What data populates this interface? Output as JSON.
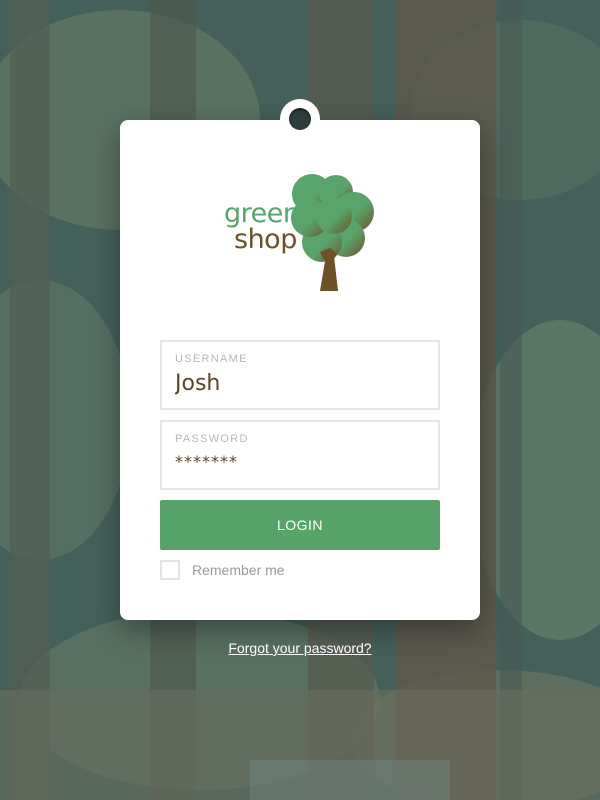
{
  "brand": {
    "line1": "green",
    "line2": "shop",
    "green_color": "#58a56a",
    "brown_color": "#6e5126",
    "logo_icon": "tree-icon"
  },
  "form": {
    "username": {
      "label": "USERNAME",
      "value": "Josh"
    },
    "password": {
      "label": "PASSWORD",
      "value": "*******"
    },
    "login_label": "LOGIN",
    "remember_label": "Remember me",
    "remember_checked": false
  },
  "footer": {
    "forgot_label": "Forgot your password?"
  },
  "colors": {
    "accent": "#57a36a",
    "card": "#ffffff",
    "text_brown": "#5d4420"
  }
}
